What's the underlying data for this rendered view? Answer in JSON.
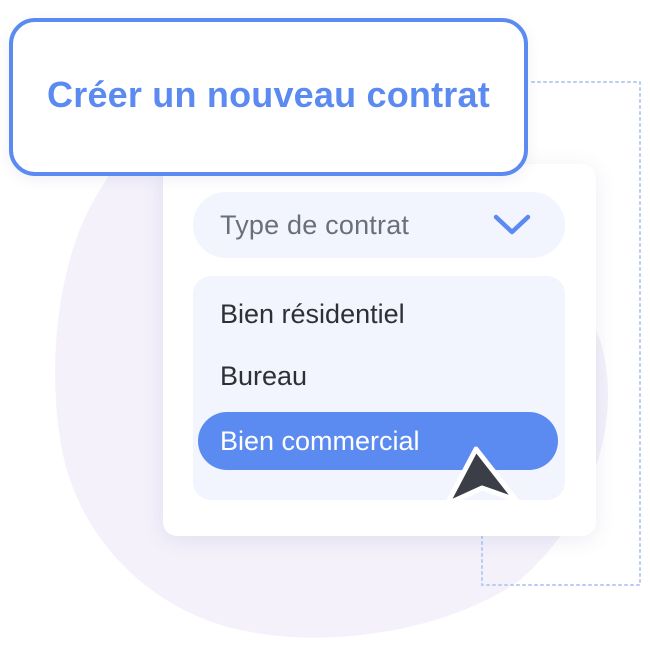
{
  "dialog": {
    "title": "Créer un nouveau contrat"
  },
  "select": {
    "label": "Type de contrat",
    "toggle_icon": "chevron-down-icon"
  },
  "options": [
    {
      "label": "Bien résidentiel",
      "selected": false
    },
    {
      "label": "Bureau",
      "selected": false
    },
    {
      "label": "Bien commercial",
      "selected": true
    }
  ],
  "pointer": {
    "icon": "cursor-arrow-icon"
  },
  "colors": {
    "accent": "#5b8af0",
    "text_dark": "#2e3038",
    "text_muted": "#6b6f7a",
    "field_bg": "#f2f5fd",
    "blob": "#f3f0fb",
    "cursor": "#3b3d47"
  }
}
